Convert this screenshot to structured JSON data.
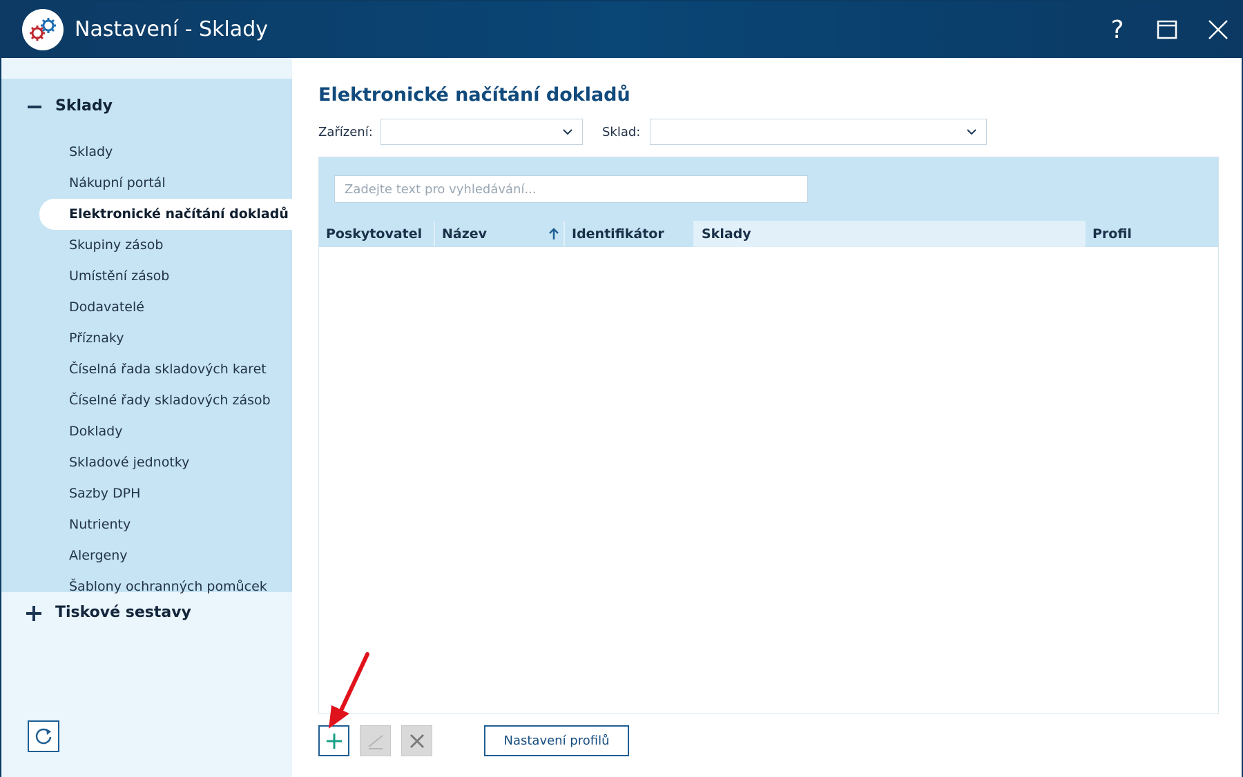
{
  "window": {
    "title": "Nastavení - Sklady",
    "help_glyph": "?"
  },
  "sidebar": {
    "group_title": "Sklady",
    "items": [
      {
        "label": "Sklady"
      },
      {
        "label": "Nákupní portál"
      },
      {
        "label": "Elektronické načítání dokladů",
        "active": true
      },
      {
        "label": "Skupiny zásob"
      },
      {
        "label": "Umístění zásob"
      },
      {
        "label": "Dodavatelé"
      },
      {
        "label": "Příznaky"
      },
      {
        "label": "Číselná řada skladových karet"
      },
      {
        "label": "Číselné řady skladových zásob"
      },
      {
        "label": "Doklady"
      },
      {
        "label": "Skladové jednotky"
      },
      {
        "label": "Sazby DPH"
      },
      {
        "label": "Nutrienty"
      },
      {
        "label": "Alergeny"
      },
      {
        "label": "Šablony ochranných pomůcek"
      }
    ],
    "group2_title": "Tiskové sestavy"
  },
  "main": {
    "page_title": "Elektronické načítání dokladů",
    "filters": {
      "device_label": "Zařízení:",
      "device_value": "",
      "warehouse_label": "Sklad:",
      "warehouse_value": ""
    },
    "search": {
      "placeholder": "Zadejte text pro vyhledávání..."
    },
    "columns": [
      "Poskytovatel",
      "Název",
      "Identifikátor",
      "Sklady",
      "Profil"
    ],
    "sort": {
      "column": "Název",
      "direction": "ascending"
    },
    "rows": [],
    "toolbar": {
      "profiles_button": "Nastavení profilů"
    }
  },
  "colors": {
    "titlebar": "#0c3a64",
    "sidebar_group": "#c6e4f3",
    "accent": "#114a7c",
    "add_icon": "#16a085",
    "annotation_arrow": "#e0121b"
  }
}
